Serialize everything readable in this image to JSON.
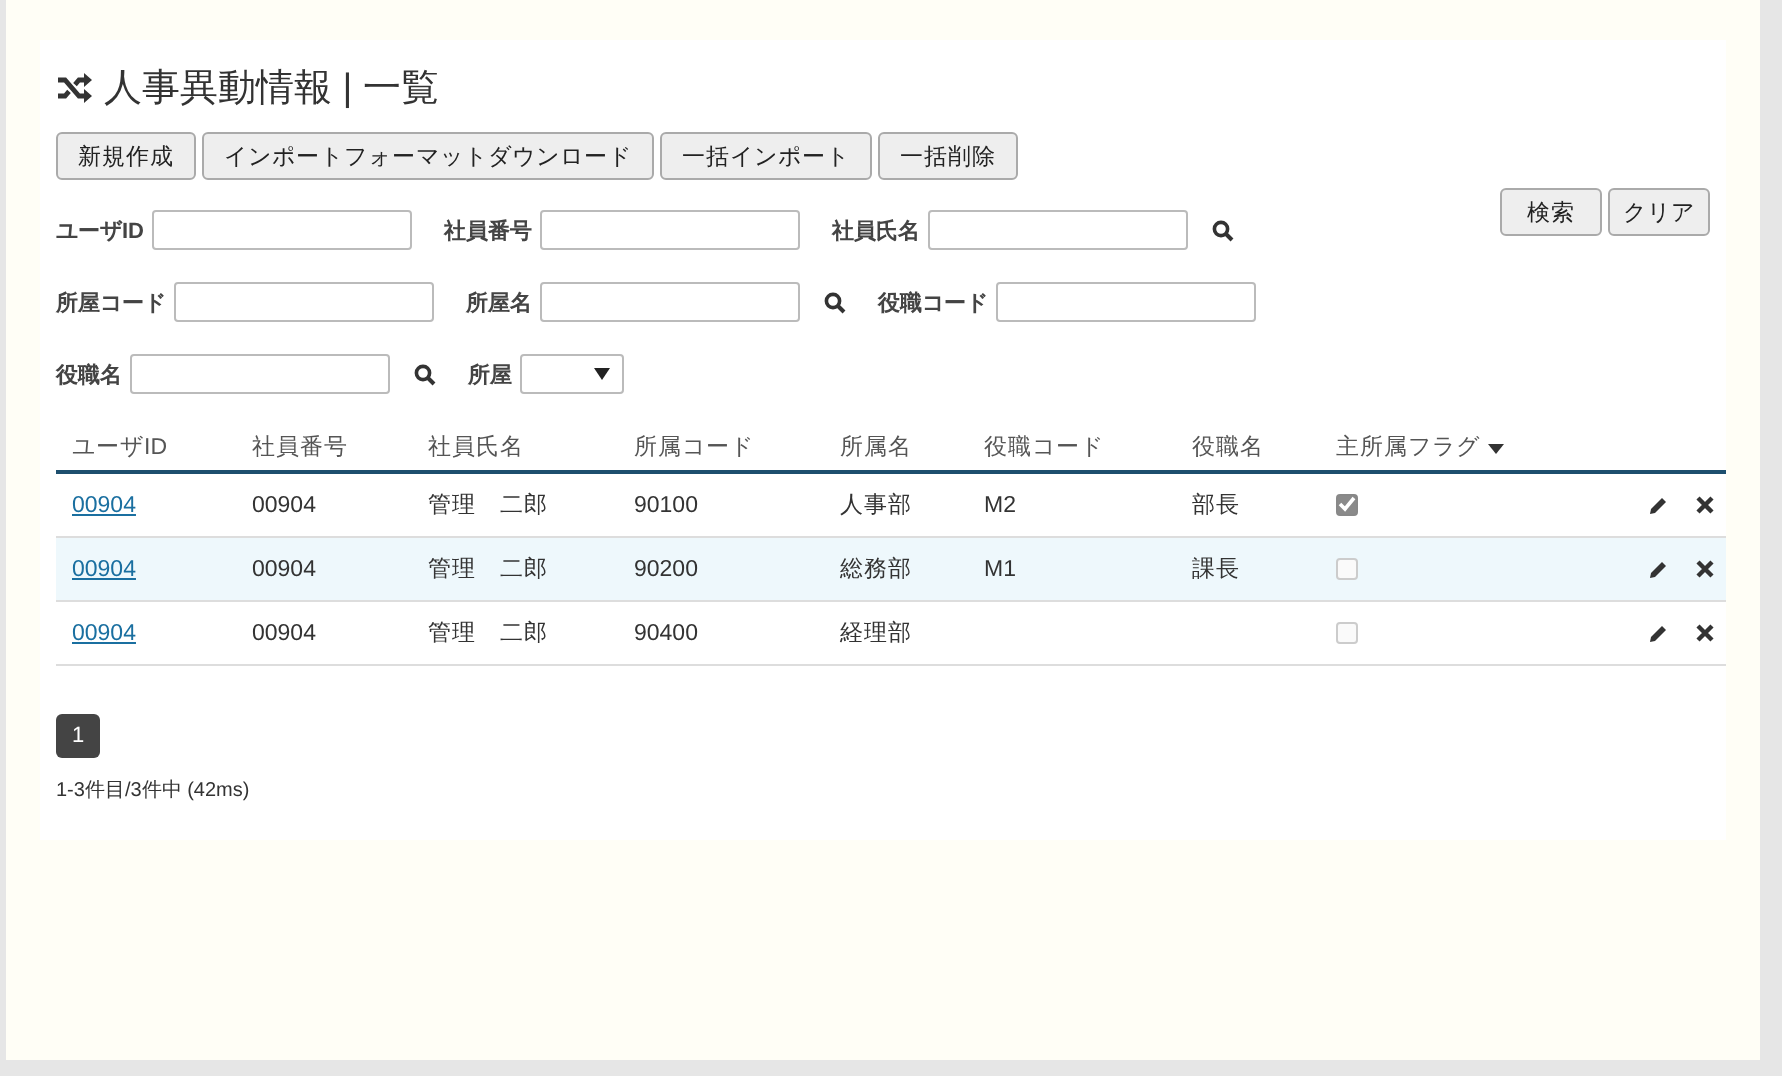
{
  "page": {
    "title": "人事異動情報 | 一覧"
  },
  "action_buttons": [
    "新規作成",
    "インポートフォーマットダウンロード",
    "一括インポート",
    "一括削除"
  ],
  "filters": [
    [
      {
        "label": "ユーザID",
        "kind": "text",
        "lookup": false
      },
      {
        "label": "社員番号",
        "kind": "text",
        "lookup": false
      },
      {
        "label": "社員氏名",
        "kind": "text",
        "lookup": true
      }
    ],
    [
      {
        "label": "所屋コード",
        "kind": "text",
        "lookup": false
      },
      {
        "label": "所屋名",
        "kind": "text",
        "lookup": true
      },
      {
        "label": "役職コード",
        "kind": "text",
        "lookup": false
      }
    ],
    [
      {
        "label": "役職名",
        "kind": "text",
        "lookup": true
      },
      {
        "label": "所屋",
        "kind": "select",
        "lookup": false
      }
    ]
  ],
  "search_buttons": [
    "検索",
    "クリア"
  ],
  "table": {
    "columns": [
      {
        "label": "ユーザID",
        "sorted": false
      },
      {
        "label": "社員番号",
        "sorted": false
      },
      {
        "label": "社員氏名",
        "sorted": false
      },
      {
        "label": "所属コード",
        "sorted": false
      },
      {
        "label": "所属名",
        "sorted": false
      },
      {
        "label": "役職コード",
        "sorted": false
      },
      {
        "label": "役職名",
        "sorted": false
      },
      {
        "label": "主所属フラグ",
        "sorted": true
      }
    ],
    "rows": [
      {
        "user_id": "00904",
        "employee_no": "00904",
        "name": "管理　二郎",
        "dept_code": "90100",
        "dept_name": "人事部",
        "post_code": "M2",
        "post_name": "部長",
        "main_flag": true,
        "highlighted": false
      },
      {
        "user_id": "00904",
        "employee_no": "00904",
        "name": "管理　二郎",
        "dept_code": "90200",
        "dept_name": "総務部",
        "post_code": "M1",
        "post_name": "課長",
        "main_flag": false,
        "highlighted": true
      },
      {
        "user_id": "00904",
        "employee_no": "00904",
        "name": "管理　二郎",
        "dept_code": "90400",
        "dept_name": "経理部",
        "main_flag": false,
        "highlighted": false
      }
    ]
  },
  "pagination": [
    {
      "label": "1",
      "selected": true
    }
  ],
  "status": "1-3件目/3件中 (42ms)"
}
